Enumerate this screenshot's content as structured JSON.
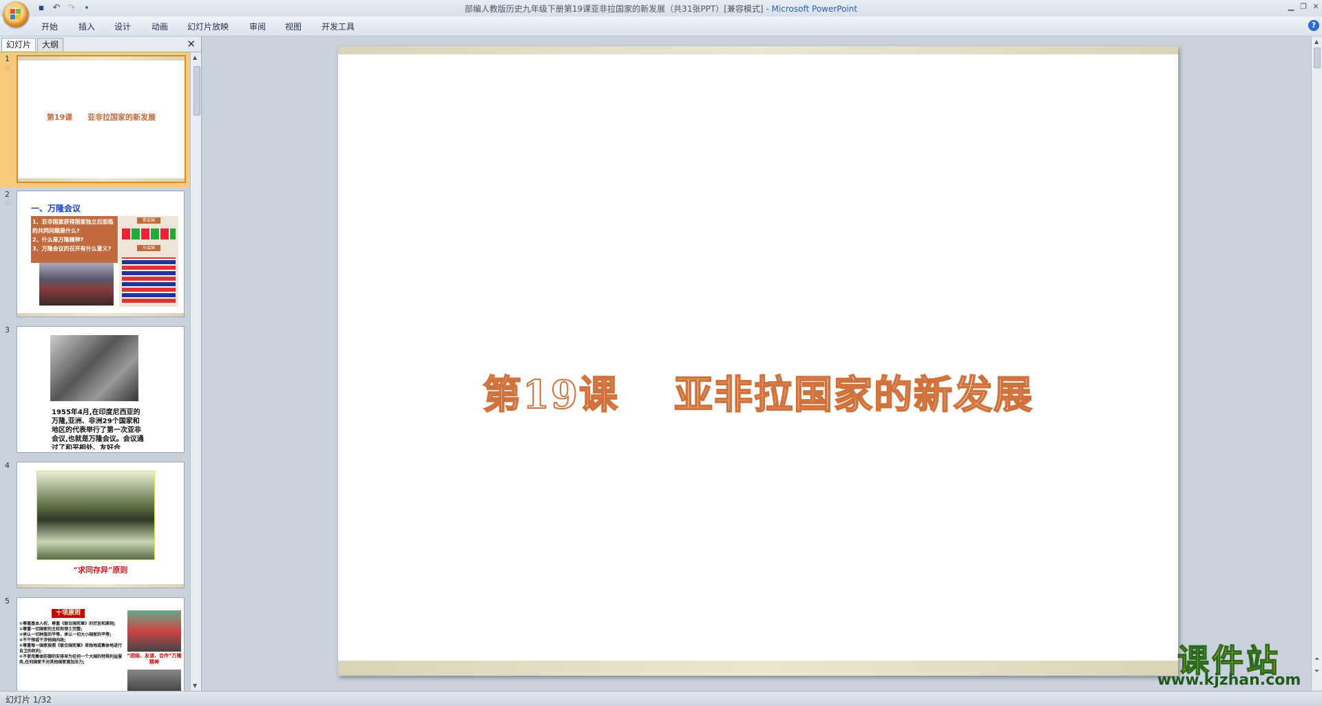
{
  "window": {
    "title": "部编人教版历史九年级下册第19课亚非拉国家的新发展（共31张PPT）[兼容模式]",
    "separator": " - ",
    "app_name": "Microsoft PowerPoint"
  },
  "ribbon": {
    "tabs": [
      "开始",
      "插入",
      "设计",
      "动画",
      "幻灯片放映",
      "审阅",
      "视图",
      "开发工具"
    ],
    "help_label": "?"
  },
  "left_pane": {
    "tabs": [
      "幻灯片",
      "大纲"
    ],
    "close_label": "✕",
    "thumbnails": [
      {
        "number": "1",
        "title": "第19课　　亚非拉国家的新发展"
      },
      {
        "number": "2",
        "heading": "一、万隆会议",
        "lines": [
          "1、亚非国家获得国家独立后面临的共同问题是什么?",
          "2、什么是万隆精神?",
          "3、万隆会议的召开有什么意义?"
        ],
        "badge_top": "参会国",
        "badge_mid": "与会国"
      },
      {
        "number": "3",
        "caption": "1955年4月,在印度尼西亚的万隆,亚洲、非洲29个国家和地区的代表举行了第一次亚非会议,也就是万隆会议。会议通过了和平相处、友好合"
      },
      {
        "number": "4",
        "caption": "“求同存异”原则"
      },
      {
        "number": "5",
        "badge": "十项原则",
        "lines": [
          "①尊重基本人权、尊重《联合国宪章》的宗旨和原则;",
          "②尊重一切国家的主权和领土完整;",
          "③承认一切种族的平等、承认一切大小国家的平等;",
          "④不干预或干涉他国内政;",
          "⑤尊重每一国家按照《联合国宪章》单独地或集体地进行自卫的权利;",
          "⑥不使用集体防御的安排来为任何一个大国的特殊利益服务,任何国家不对其他国家施加压力;"
        ],
        "photo_caption": "“团结、友谊、合作”万隆精神"
      }
    ]
  },
  "main_slide": {
    "title_part1": "第19课",
    "title_part2": "亚非拉国家的新发展"
  },
  "status": {
    "slide_indicator": "幻灯片 1/32"
  },
  "watermark": {
    "brand": "课件站",
    "url": "www.kjzhan.com"
  }
}
